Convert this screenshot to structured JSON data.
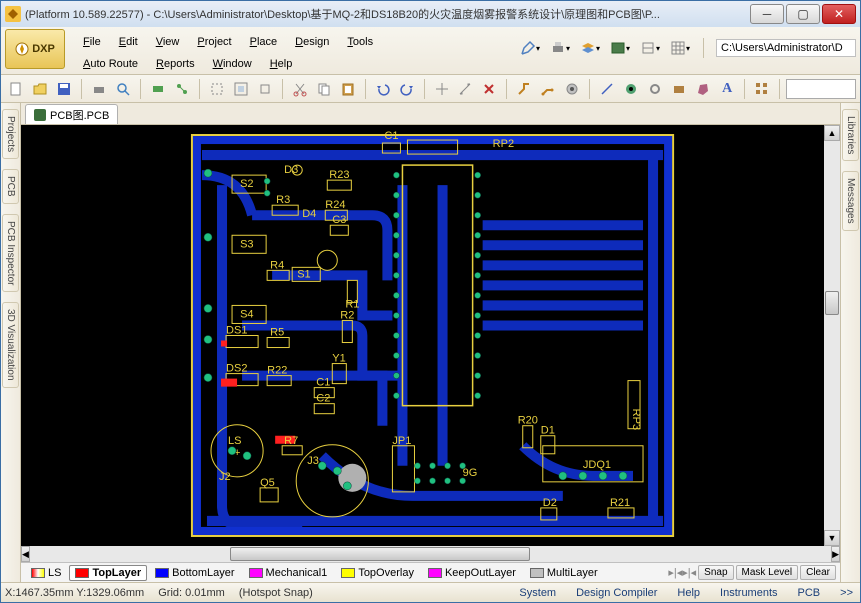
{
  "window": {
    "title": "(Platform 10.589.22577) - C:\\Users\\Administrator\\Desktop\\基于MQ-2和DS18B20的火灾温度烟雾报警系统设计\\原理图和PCB图\\P..."
  },
  "menu": {
    "dxp": "DXP",
    "top": [
      "File",
      "Edit",
      "View",
      "Project",
      "Place",
      "Design",
      "Tools"
    ],
    "bottom": [
      "Auto Route",
      "Reports",
      "Window",
      "Help"
    ]
  },
  "right_path": "C:\\Users\\Administrator\\D",
  "doc_tab": "PCB图.PCB",
  "side_panels": {
    "left": [
      "Projects",
      "PCB",
      "PCB Inspector",
      "3D Visualization"
    ],
    "right": [
      "Libraries",
      "Messages"
    ]
  },
  "layers": [
    {
      "name": "LS",
      "color_class": "ls",
      "active": false
    },
    {
      "name": "TopLayer",
      "color": "#ff0000",
      "active": true
    },
    {
      "name": "BottomLayer",
      "color": "#0000ff",
      "active": false
    },
    {
      "name": "Mechanical1",
      "color": "#ff00ff",
      "active": false
    },
    {
      "name": "TopOverlay",
      "color": "#ffff00",
      "active": false
    },
    {
      "name": "KeepOutLayer",
      "color": "#ff00ff",
      "active": false
    },
    {
      "name": "MultiLayer",
      "color": "#c0c0c0",
      "active": false
    }
  ],
  "layer_right": {
    "snap": "Snap",
    "mask": "Mask Level",
    "clear": "Clear"
  },
  "status": {
    "coord": "X:1467.35mm Y:1329.06mm",
    "grid": "Grid: 0.01mm",
    "hotspot": "(Hotspot Snap)",
    "links": [
      "System",
      "Design Compiler",
      "Help",
      "Instruments",
      "PCB",
      ">>"
    ]
  },
  "pcb_components": [
    "D3",
    "S2",
    "R23",
    "R3",
    "D4",
    "R24",
    "C3",
    "S3",
    "R4",
    "S1",
    "R1",
    "S4",
    "R2",
    "DS1",
    "R5",
    "DS2",
    "R22",
    "Y1",
    "C1",
    "C2",
    "LS",
    "J2",
    "Q5",
    "R7",
    "J3",
    "JP1",
    "R20",
    "D1",
    "RP3",
    "JDQ1",
    "D2",
    "R21",
    "C1",
    "RP2",
    "9G"
  ],
  "colors": {
    "board_bg": "#000000",
    "copper": "#1030d0",
    "silk": "#e8d040",
    "pad": "#20c080",
    "red": "#ff2020",
    "gray": "#b0b0b0"
  }
}
